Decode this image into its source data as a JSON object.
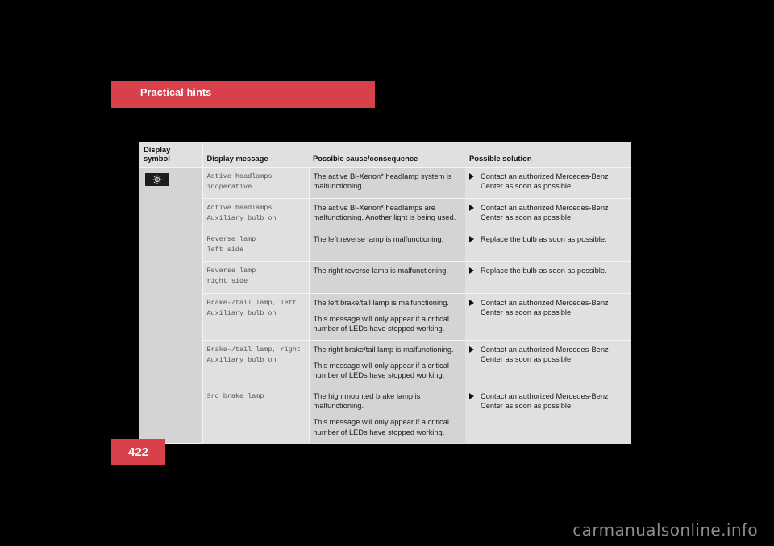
{
  "section": {
    "title": "Practical hints"
  },
  "page": {
    "number": "422"
  },
  "watermark": {
    "text": "carmanualsonline.info"
  },
  "table": {
    "headers": {
      "display_symbol": "Display symbol",
      "display_message": "Display message",
      "possible_cause": "Possible cause/consequence",
      "possible_solution": "Possible solution"
    },
    "symbol": {
      "icon_name": "headlamp-indicator-icon",
      "background": "#1c1c1c",
      "glyph_color": "#d6d6d6"
    },
    "rows": [
      {
        "display_message": "Active headlamps\ninoperative",
        "cause": [
          "The active Bi-Xenon* headlamp system is malfunctioning."
        ],
        "solution": [
          "Contact an authorized Mercedes-Benz Center as soon as possible."
        ]
      },
      {
        "display_message": "Active headlamps\nAuxiliary bulb on",
        "cause": [
          "The active Bi-Xenon* headlamps are malfunctioning. Another light is being used."
        ],
        "solution": [
          "Contact an authorized Mercedes-Benz Center as soon as possible."
        ]
      },
      {
        "display_message": "Reverse lamp\nleft side",
        "cause": [
          "The left reverse lamp is malfunctioning."
        ],
        "solution": [
          "Replace the bulb as soon as possible."
        ]
      },
      {
        "display_message": "Reverse lamp\nright side",
        "cause": [
          "The right reverse lamp is malfunctioning."
        ],
        "solution": [
          "Replace the bulb as soon as possible."
        ]
      },
      {
        "display_message": "Brake-/tail lamp, left\nAuxiliary bulb on",
        "cause": [
          "The left brake/tail lamp is malfunctioning.",
          "This message will only appear if a critical number of LEDs have stopped working."
        ],
        "solution": [
          "Contact an authorized Mercedes-Benz Center as soon as possible."
        ]
      },
      {
        "display_message": "Brake-/tail lamp, right\nAuxiliary bulb on",
        "cause": [
          "The right brake/tail lamp is malfunctioning.",
          "This message will only appear if a critical number of LEDs have stopped working."
        ],
        "solution": [
          "Contact an authorized Mercedes-Benz Center as soon as possible."
        ]
      },
      {
        "display_message": "3rd brake lamp",
        "cause": [
          "The high mounted brake lamp is malfunctioning.",
          "This message will only appear if a critical number of LEDs have stopped working."
        ],
        "solution": [
          "Contact an authorized Mercedes-Benz Center as soon as possible."
        ]
      }
    ]
  },
  "colors": {
    "accent_red": "#d8404b",
    "table_light": "#e0e0e0",
    "table_dark": "#d4d4d4",
    "page_background": "#000000"
  }
}
